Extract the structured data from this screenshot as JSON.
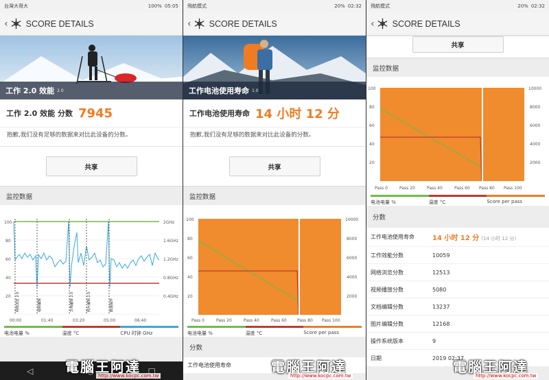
{
  "panels": [
    {
      "status": {
        "left": "台灣大哥大",
        "time": "05:05",
        "battery": "100%",
        "speed": "11.8\nK/s"
      },
      "header": {
        "back": "‹",
        "title": "SCORE DETAILS"
      },
      "hero": {
        "name": "工作 2.0 效能",
        "version": "2.0"
      },
      "score": {
        "label": "工作 2.0 效能 分数",
        "value": "7945"
      },
      "sorry": "抱歉,我们没有足够的数据来对比此设备的分数。",
      "share": "共享",
      "monitor": "监控数据",
      "legend": [
        {
          "label": "电池电量 %",
          "color": "#6dbe45"
        },
        {
          "label": "温度 °C",
          "color": "#c0392b"
        },
        {
          "label": "CPU 时钟 GHz",
          "color": "#35a8e0"
        }
      ],
      "chart": {
        "y_left": [
          "100",
          "80",
          "60",
          "40",
          "20"
        ],
        "y_right": [
          "2GHz",
          "1.6GHz",
          "1.2GHz",
          "0.8GHz",
          "0.4GHz"
        ],
        "x": [
          "00:00",
          "01:40",
          "03:20",
          "05:00",
          "06:40"
        ],
        "markers": [
          "网络浏览 2.0",
          "视频编辑",
          "文档编辑 2.0",
          "照片编辑 2.0",
          "数据操作"
        ]
      }
    },
    {
      "status": {
        "left": "飛航模式",
        "time": "02:32",
        "battery": "20%",
        "speed": "173\nB/s"
      },
      "header": {
        "back": "‹",
        "title": "SCORE DETAILS"
      },
      "hero": {
        "name": "工作电池使用寿命",
        "version": "1.0"
      },
      "score": {
        "label": "工作电池使用寿命",
        "value": "14 小时 12 分"
      },
      "sorry": "抱歉,我们没有足够的数据来对比此设备的分数。",
      "share": "共享",
      "monitor": "监控数据",
      "legend": [
        {
          "label": "电池电量 %",
          "color": "#6dbe45"
        },
        {
          "label": "温度 °C",
          "color": "#c0392b"
        },
        {
          "label": "Score per pass",
          "color": "#f07c22"
        }
      ],
      "chart": {
        "y_left": [
          "100",
          "80",
          "60",
          "40",
          "20"
        ],
        "y_right": [
          "10000",
          "8000",
          "6000",
          "4000",
          "2000"
        ],
        "x": [
          "Pass 0",
          "Pass 20",
          "Pass 40",
          "Pass 60",
          "Pass 80",
          "Pass 100"
        ]
      },
      "details_title": "分数",
      "first_row_label": "工作电池使用寿命"
    },
    {
      "status": {
        "left": "飛航模式",
        "time": "02:32",
        "battery": "20%",
        "speed": "173\nB/s"
      },
      "header": {
        "back": "‹",
        "title": "SCORE DETAILS"
      },
      "share": "共享",
      "monitor": "监控数据",
      "legend": [
        {
          "label": "电池电量 %",
          "color": "#6dbe45"
        },
        {
          "label": "温度 °C",
          "color": "#c0392b"
        },
        {
          "label": "Score per pass",
          "color": "#f07c22"
        }
      ],
      "chart": {
        "y_left": [
          "100",
          "80",
          "60",
          "40",
          "20"
        ],
        "y_right": [
          "10000",
          "8000",
          "6000",
          "4000",
          "2000"
        ],
        "x": [
          "Pass 0",
          "Pass 20",
          "Pass 40",
          "Pass 60",
          "Pass 80",
          "Pass 100"
        ]
      },
      "details_title": "分数",
      "rows": [
        {
          "k": "工作电池使用寿命",
          "v": "14 小时 12 分",
          "small": "(14 小时 12 分)",
          "hl": true
        },
        {
          "k": "工作效能分数",
          "v": "10059"
        },
        {
          "k": "网络浏览分数",
          "v": "12513"
        },
        {
          "k": "视频播放分数",
          "v": "5080"
        },
        {
          "k": "文档编辑分数",
          "v": "13237"
        },
        {
          "k": "图片编辑分数",
          "v": "12168"
        },
        {
          "k": "操作系统版本",
          "v": "9"
        },
        {
          "k": "日期",
          "v": "2019 02:37"
        }
      ]
    }
  ],
  "watermark": {
    "text": "電腦王阿達",
    "url": "http://www.kocpc.com.tw"
  },
  "nav": {
    "back": "◁",
    "home": "○",
    "recent": "□"
  }
}
